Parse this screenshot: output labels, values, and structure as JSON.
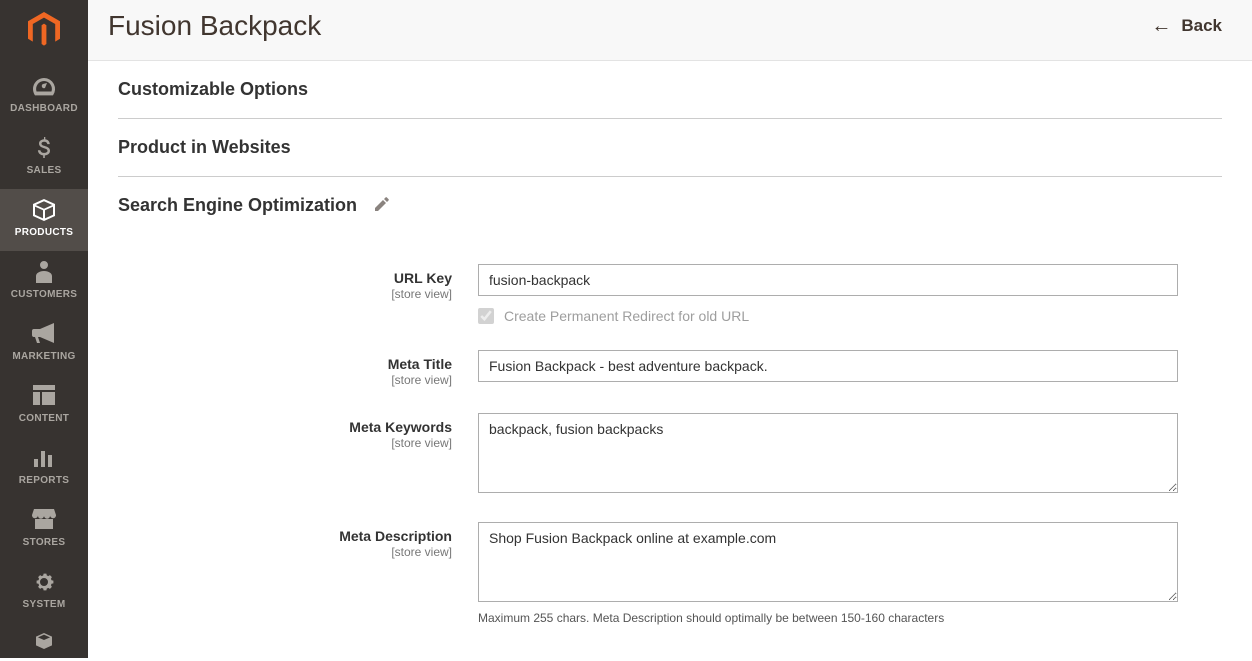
{
  "sidebar": {
    "items": [
      {
        "label": "DASHBOARD"
      },
      {
        "label": "SALES"
      },
      {
        "label": "PRODUCTS"
      },
      {
        "label": "CUSTOMERS"
      },
      {
        "label": "MARKETING"
      },
      {
        "label": "CONTENT"
      },
      {
        "label": "REPORTS"
      },
      {
        "label": "STORES"
      },
      {
        "label": "SYSTEM"
      }
    ]
  },
  "header": {
    "title": "Fusion Backpack",
    "back_label": "Back"
  },
  "sections": {
    "customizable_options": "Customizable Options",
    "product_in_websites": "Product in Websites",
    "seo": "Search Engine Optimization"
  },
  "scope_label": "[store view]",
  "fields": {
    "url_key": {
      "label": "URL Key",
      "value": "fusion-backpack",
      "redirect_label": "Create Permanent Redirect for old URL"
    },
    "meta_title": {
      "label": "Meta Title",
      "value": "Fusion Backpack - best adventure backpack."
    },
    "meta_keywords": {
      "label": "Meta Keywords",
      "value": "backpack, fusion backpacks"
    },
    "meta_description": {
      "label": "Meta Description",
      "value": "Shop Fusion Backpack online at example.com",
      "note": "Maximum 255 chars. Meta Description should optimally be between 150-160 characters"
    }
  }
}
